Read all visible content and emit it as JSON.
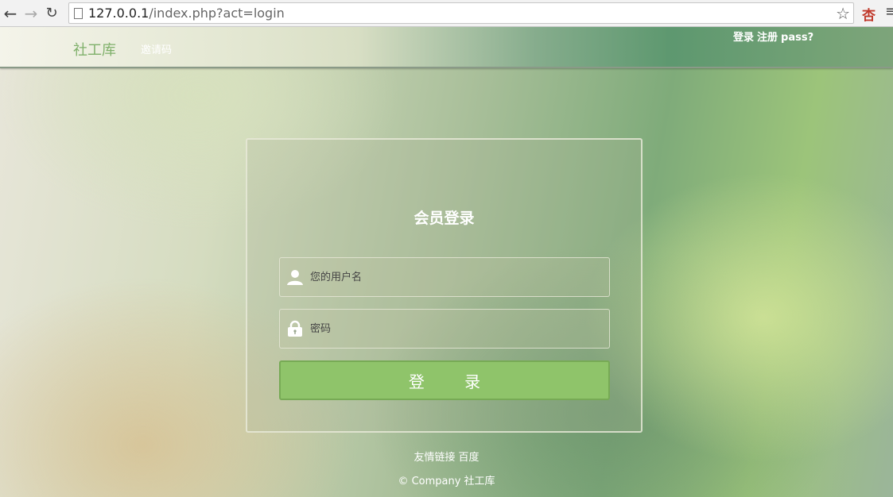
{
  "browser": {
    "url_host": "127.0.0.1",
    "url_rest": "/index.php?act=login",
    "back_icon": "arrow-left-icon",
    "forward_icon": "arrow-right-icon",
    "reload_icon": "reload-icon",
    "bookmark_icon": "star-icon",
    "extension_text": "杏",
    "menu_icon": "hamburger-menu-icon"
  },
  "nav": {
    "brand": "社工库",
    "invite": "邀请码",
    "links": [
      "登录",
      "注册",
      "pass?"
    ]
  },
  "login": {
    "title": "会员登录",
    "username_placeholder": "您的用户名",
    "password_placeholder": "密码",
    "submit_label": "登 录"
  },
  "footer": {
    "friend_links_label": "友情链接",
    "friend_link": "百度",
    "copyright": "© Company 社工库"
  },
  "colors": {
    "brand": "#7fb06a",
    "button": "#8fc46a"
  }
}
